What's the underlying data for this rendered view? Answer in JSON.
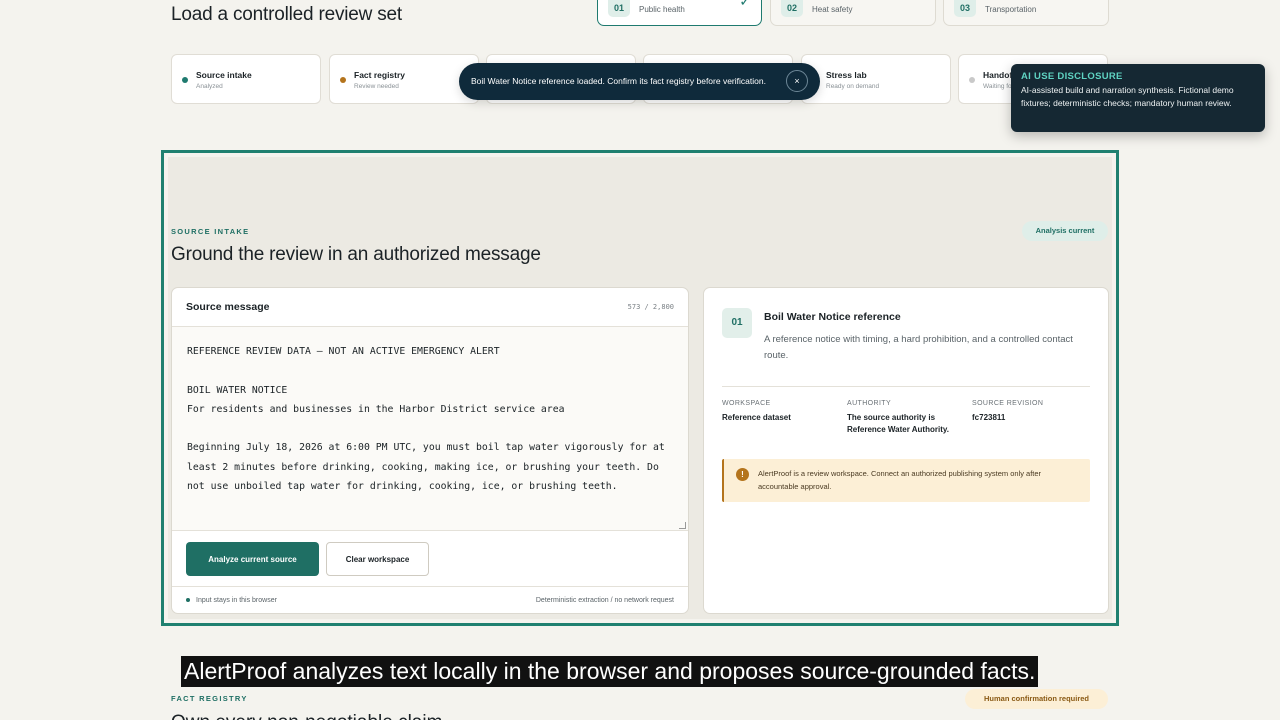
{
  "header": {
    "title": "Load a controlled review set"
  },
  "scenarios": [
    {
      "number": "01",
      "label": "Public health",
      "active": true
    },
    {
      "number": "02",
      "label": "Heat safety",
      "active": false
    },
    {
      "number": "03",
      "label": "Transportation",
      "active": false
    }
  ],
  "steps": [
    {
      "title": "Source intake",
      "status": "Analyzed",
      "color": "#1f7a6f"
    },
    {
      "title": "Fact registry",
      "status": "Review needed",
      "color": "#b4741c"
    },
    {
      "title": "",
      "status": "",
      "color": "#c9c9c9"
    },
    {
      "title": "",
      "status": "",
      "color": "#c9c9c9"
    },
    {
      "title": "Stress lab",
      "status": "Ready on demand",
      "color": "#c9c9c9"
    },
    {
      "title": "Handoff",
      "status": "Waiting for",
      "color": "#c9c9c9"
    }
  ],
  "toast": {
    "message": "Boil Water Notice reference loaded. Confirm its fact registry before verification.",
    "close_label": "×"
  },
  "disclosure": {
    "title": "AI USE DISCLOSURE",
    "text": "AI-assisted build and narration synthesis. Fictional demo fixtures; deterministic checks; mandatory human review."
  },
  "source_intake": {
    "eyebrow": "SOURCE INTAKE",
    "heading": "Ground the review in an authorized message",
    "status_pill": "Analysis current",
    "card_title": "Source message",
    "char_count": "573 / 2,800",
    "text": "REFERENCE REVIEW DATA — NOT AN ACTIVE EMERGENCY ALERT\n\nBOIL WATER NOTICE\nFor residents and businesses in the Harbor District service area\n\nBeginning July 18, 2026 at 6:00 PM UTC, you must boil tap water vigorously for at least 2 minutes before drinking, cooking, making ice, or brushing your teeth. Do not use unboiled tap water for drinking, cooking, ice, or brushing teeth.",
    "analyze_button": "Analyze current source",
    "clear_button": "Clear workspace",
    "footer_left": "Input stays in this browser",
    "footer_right": "Deterministic extraction / no network request"
  },
  "reference": {
    "badge": "01",
    "title": "Boil Water Notice reference",
    "description": "A reference notice with timing, a hard prohibition, and a controlled contact route.",
    "meta": [
      {
        "key": "WORKSPACE",
        "value": "Reference dataset"
      },
      {
        "key": "AUTHORITY",
        "value": "The source authority is Reference Water Authority."
      },
      {
        "key": "SOURCE REVISION",
        "value": "fc723811"
      }
    ],
    "notice_icon": "!",
    "notice": "AlertProof is a review workspace. Connect an authorized publishing system only after accountable approval."
  },
  "caption": "AlertProof analyzes text locally in the browser and proposes source-grounded facts.",
  "fact_registry": {
    "eyebrow": "FACT REGISTRY",
    "status_pill": "Human confirmation required",
    "heading": "Own every non-negotiable claim"
  },
  "colors": {
    "accent": "#1f6f64",
    "frame": "#1f8070",
    "toast_bg": "#0f2a3b",
    "disclosure_bg": "#152833",
    "warning": "#b4741c"
  }
}
